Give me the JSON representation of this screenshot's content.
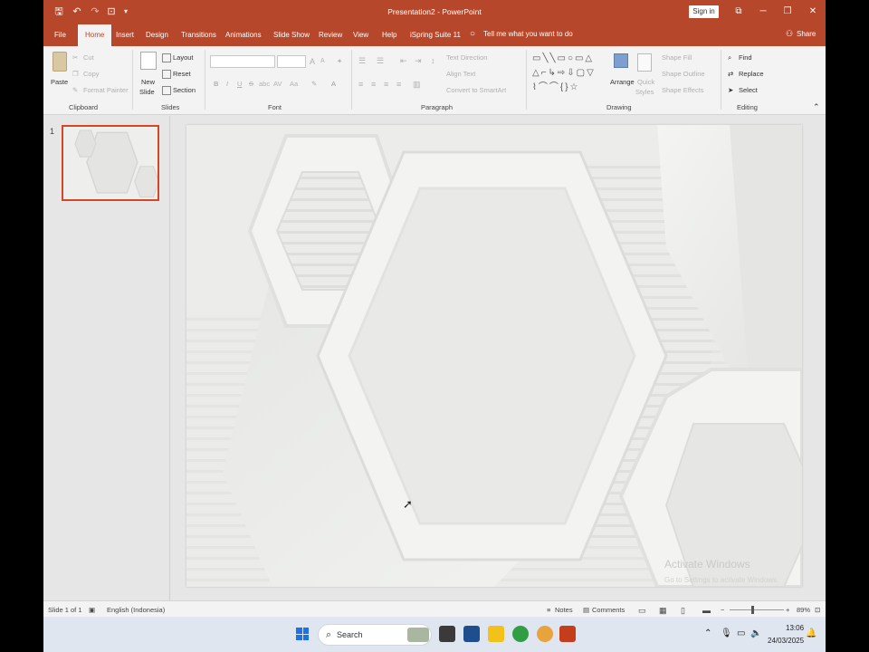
{
  "window": {
    "title": "Presentation2  -  PowerPoint",
    "signin": "Sign in",
    "controls": {
      "minimize": "─",
      "restore": "❐",
      "close": "✕",
      "display": "⧉"
    }
  },
  "quick_access": {
    "save": "🖫",
    "undo": "↶",
    "redo": "↷",
    "present": "⊡",
    "customize": "▾"
  },
  "tabs": [
    "File",
    "Home",
    "Insert",
    "Design",
    "Transitions",
    "Animations",
    "Slide Show",
    "Review",
    "View",
    "Help",
    "iSpring Suite 11"
  ],
  "active_tab": "Home",
  "tell_me": "Tell me what you want to do",
  "share": "Share",
  "ribbon": {
    "clipboard": {
      "label": "Clipboard",
      "paste": "Paste",
      "cut": "Cut",
      "copy": "Copy",
      "format_painter": "Format Painter"
    },
    "slides": {
      "label": "Slides",
      "new_slide": "New",
      "new_slide2": "Slide",
      "layout": "Layout",
      "reset": "Reset",
      "section": "Section"
    },
    "font": {
      "label": "Font",
      "bold": "B",
      "italic": "I",
      "underline": "U",
      "strike": "S",
      "shadow": "abc",
      "spacing": "AV",
      "case": "Aa",
      "grow": "A",
      "shrink": "A"
    },
    "paragraph": {
      "label": "Paragraph",
      "text_direction": "Text Direction",
      "align_text": "Align Text",
      "smartart": "Convert to SmartArt"
    },
    "drawing": {
      "label": "Drawing",
      "arrange": "Arrange",
      "quick_styles": "Quick",
      "quick_styles2": "Styles",
      "shape_fill": "Shape Fill",
      "shape_outline": "Shape Outline",
      "shape_effects": "Shape Effects"
    },
    "editing": {
      "label": "Editing",
      "find": "Find",
      "replace": "Replace",
      "select": "Select"
    }
  },
  "thumbnails": {
    "slide_number": "1"
  },
  "watermark": {
    "line1": "Activate Windows",
    "line2": "Go to Settings to activate Windows."
  },
  "status": {
    "slide_of": "Slide 1 of 1",
    "language": "English (Indonesia)",
    "notes": "Notes",
    "comments": "Comments",
    "zoom_minus": "−",
    "zoom_plus": "+",
    "zoom": "89%"
  },
  "taskbar": {
    "search": "Search",
    "time": "13:06",
    "date": "24/03/2025"
  },
  "colors": {
    "accent": "#b7472a",
    "ribbon_bg": "#f3f3f3",
    "slide_bg": "#ecedeb",
    "taskbar_bg": "#dfe6ef"
  }
}
